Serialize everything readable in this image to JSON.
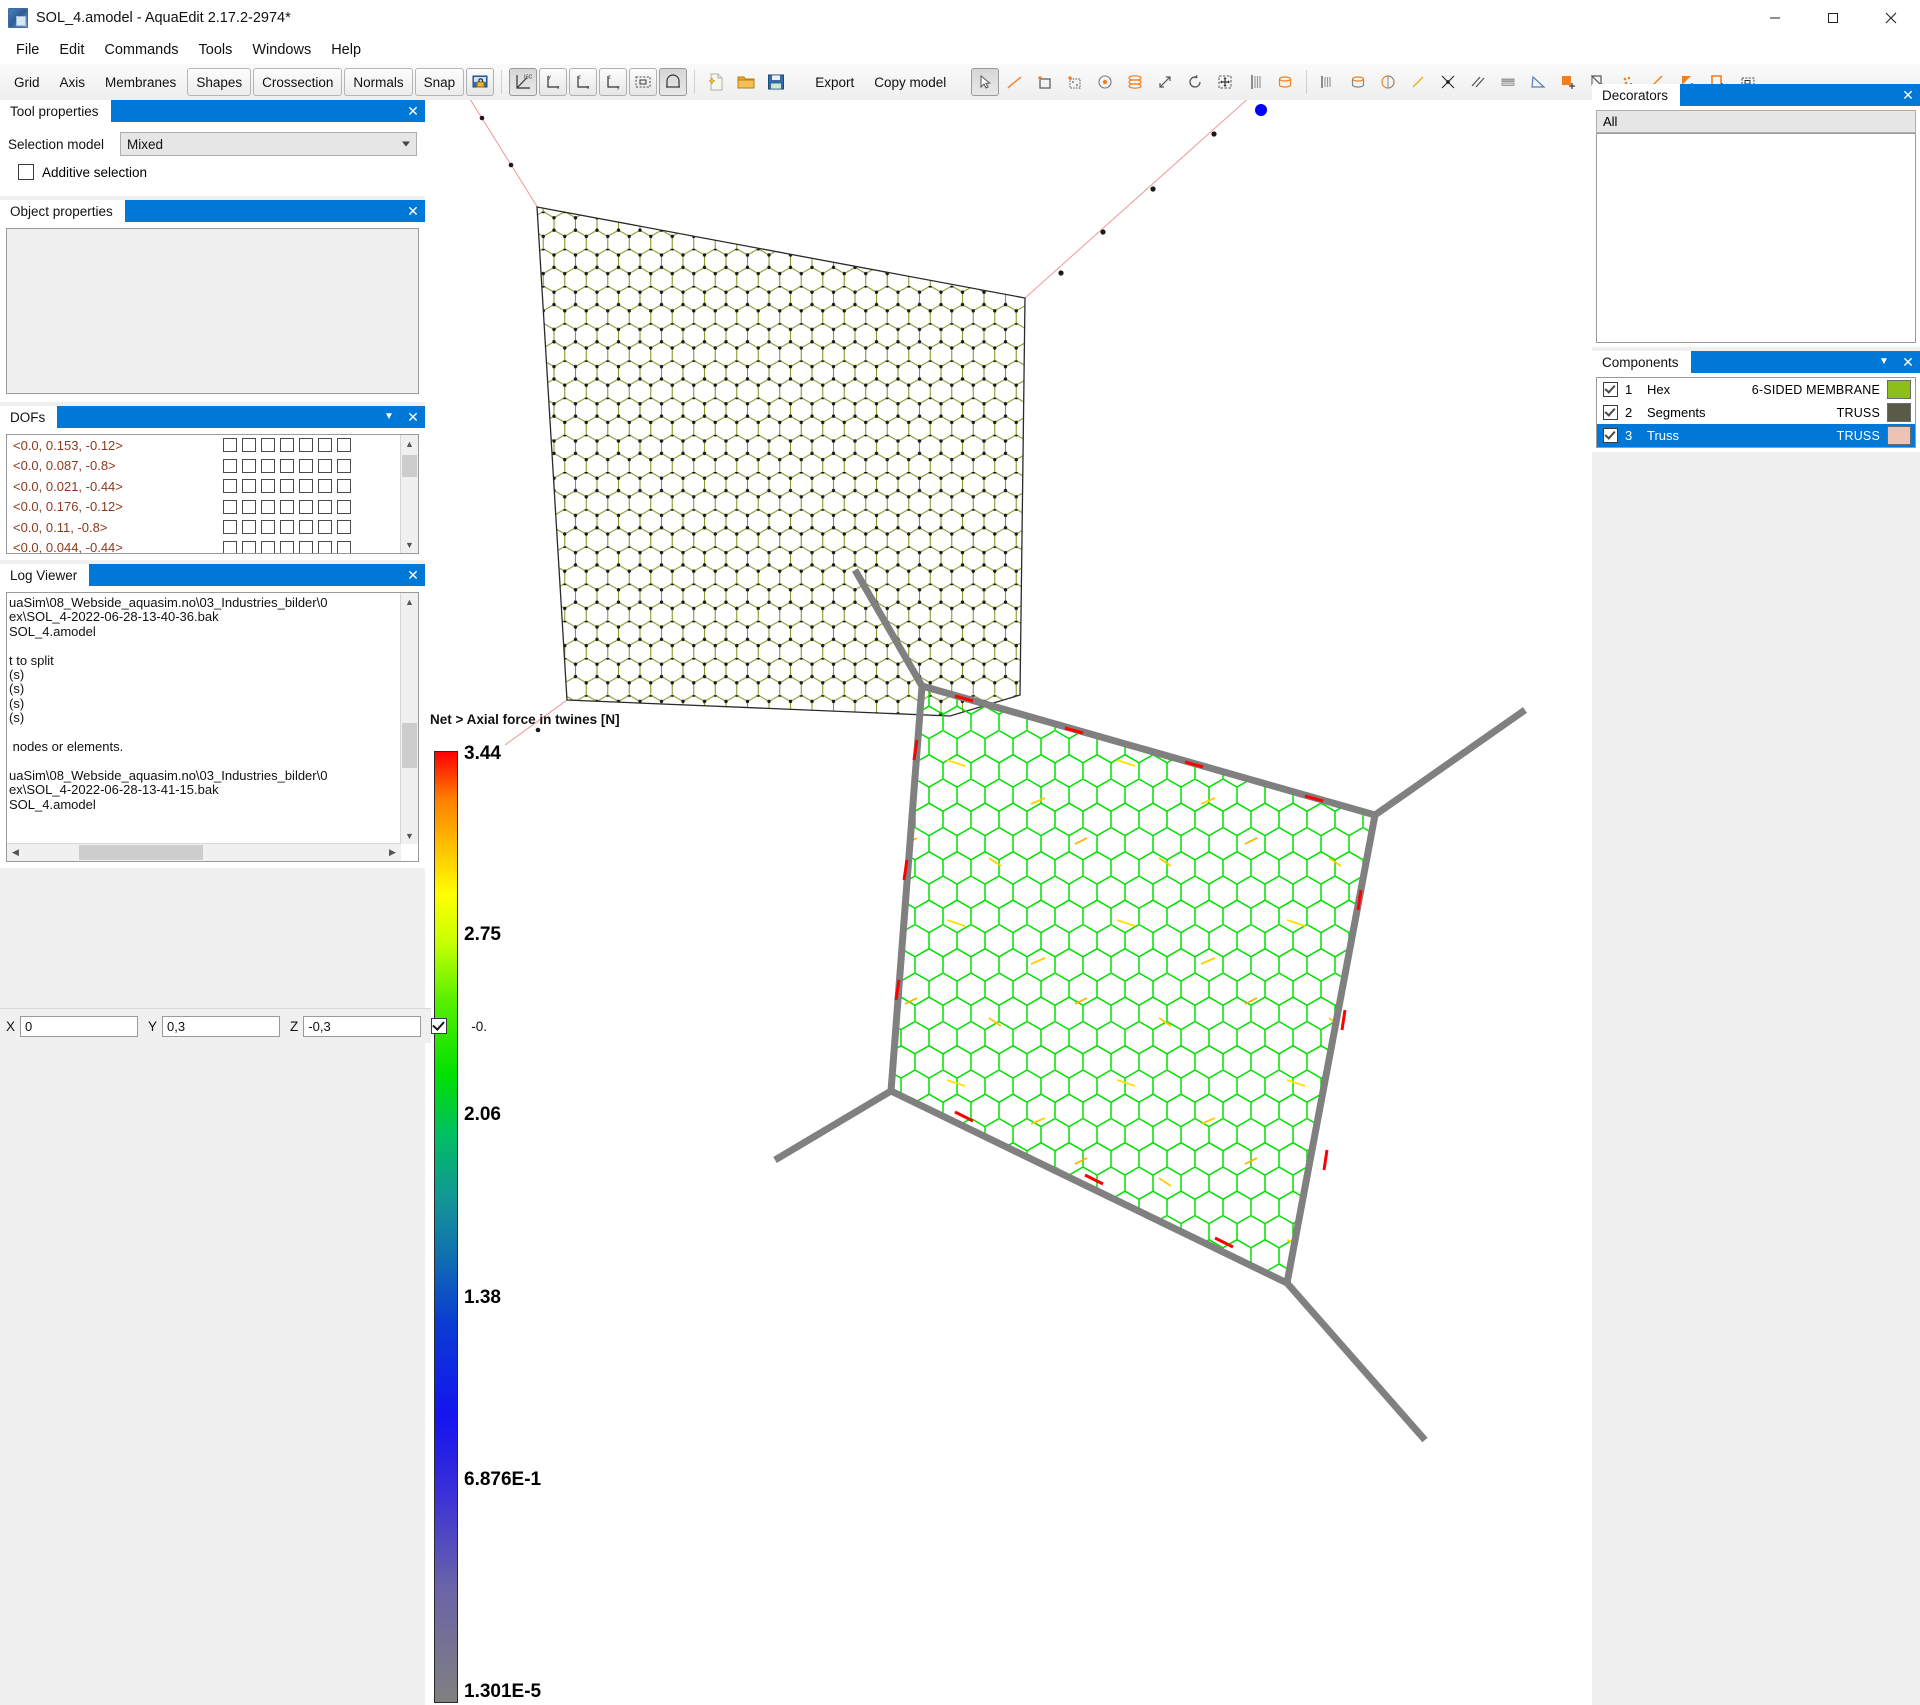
{
  "window": {
    "title": "SOL_4.amodel - AquaEdit 2.17.2-2974*",
    "minimize": "–",
    "maximize": "❐",
    "close": "✕"
  },
  "menu": {
    "items": [
      "File",
      "Edit",
      "Commands",
      "Tools",
      "Windows",
      "Help"
    ]
  },
  "toolbar": {
    "mode_buttons": [
      "Grid",
      "Axis",
      "Membranes",
      "Shapes",
      "Crossection",
      "Normals",
      "Snap"
    ],
    "active_mode": "Shapes",
    "lock_icon": "lock-view-icon",
    "view_icons": [
      "iso-view-icon",
      "yx-view-icon",
      "zx-view-icon",
      "zy-view-icon",
      "zoom-fit-icon",
      "membrane-view-icon"
    ],
    "file_icons": [
      "new-file-icon",
      "open-folder-icon",
      "save-disk-icon"
    ],
    "export_label": "Export",
    "copy_model_label": "Copy model",
    "edit_icons": [
      "select-arrow-icon",
      "draw-line-icon",
      "add-rect-icon",
      "add-mesh-icon",
      "add-point-icon",
      "add-volume-icon",
      "scale-icon",
      "rotate-icon",
      "move-icon",
      "mirror-icon",
      "extrude-icon",
      "split-cylinder-icon",
      "half-circle-icon",
      "line-segment-icon",
      "intersect-icon",
      "parallel-icon",
      "offset-icon",
      "angle-icon",
      "fill-square-icon",
      "copy-shape-icon",
      "points-add-icon",
      "line-add-icon",
      "triangle-add-icon",
      "square-add-icon",
      "bounding-box-icon"
    ]
  },
  "tool_properties": {
    "tab": "Tool properties",
    "close": "✕",
    "selection_model_label": "Selection model",
    "selection_model_value": "Mixed",
    "additive_selection_label": "Additive selection",
    "additive_selection_checked": false
  },
  "object_properties": {
    "tab": "Object properties",
    "close": "✕",
    "content": ""
  },
  "dofs": {
    "tab": "DOFs",
    "menu": "▼",
    "close": "✕",
    "checkbox_count": 7,
    "rows": [
      "<0.0, 0.153, -0.12>",
      "<0.0, 0.087, -0.8>",
      "<0.0, 0.021, -0.44>",
      "<0.0, 0.176, -0.12>",
      "<0.0, 0.11, -0.8>",
      "<0.0, 0.044, -0.44>"
    ]
  },
  "log_viewer": {
    "tab": "Log Viewer",
    "close": "✕",
    "lines": [
      "uaSim\\08_Webside_aquasim.no\\03_Industries_bilder\\0",
      "ex\\SOL_4-2022-06-28-13-40-36.bak",
      "SOL_4.amodel",
      "",
      "t to split",
      "(s)",
      "(s)",
      "(s)",
      "(s)",
      "",
      " nodes or elements.",
      "",
      "uaSim\\08_Webside_aquasim.no\\03_Industries_bilder\\0",
      "ex\\SOL_4-2022-06-28-13-41-15.bak",
      "SOL_4.amodel"
    ]
  },
  "coordbar": {
    "x_label": "X",
    "x_value": "0",
    "y_label": "Y",
    "y_value": "0,3",
    "z_label": "Z",
    "z_value": "-0,3",
    "lock_checked": true,
    "extra_value": "-0."
  },
  "decorators": {
    "tab": "Decorators",
    "close": "✕",
    "filter_value": "All",
    "items": []
  },
  "components": {
    "tab": "Components",
    "menu": "▼",
    "close": "✕",
    "rows": [
      {
        "index": "1",
        "name": "Hex",
        "type": "6-SIDED MEMBRANE",
        "color": "#8CC019",
        "checked": true,
        "selected": false
      },
      {
        "index": "2",
        "name": "Segments",
        "type": "TRUSS",
        "color": "#5A5A48",
        "checked": true,
        "selected": false
      },
      {
        "index": "3",
        "name": "Truss",
        "type": "TRUSS",
        "color": "#EFC3B4",
        "checked": true,
        "selected": true
      }
    ]
  },
  "legend": {
    "title": "Net > Axial force in twines [N]",
    "ticks": [
      "3.44",
      "2.75",
      "2.06",
      "1.38",
      "6.876E-1",
      "1.301E-5"
    ]
  },
  "chart_data": {
    "type": "heatmap",
    "title": "Net > Axial force in twines [N]",
    "colorbar_ticks": [
      3.44,
      2.75,
      2.06,
      1.38,
      0.6876,
      1.301e-05
    ],
    "colorbar_tick_labels": [
      "3.44",
      "2.75",
      "2.06",
      "1.38",
      "6.876E-1",
      "1.301E-5"
    ],
    "vmin": 1.301e-05,
    "vmax": 3.44,
    "unit": "N",
    "colormap_stops": [
      {
        "pos": 0.0,
        "color": "#808080"
      },
      {
        "pos": 0.12,
        "color": "#6A64A8"
      },
      {
        "pos": 0.27,
        "color": "#1414F0"
      },
      {
        "pos": 0.4,
        "color": "#0A3CD2"
      },
      {
        "pos": 0.52,
        "color": "#129696"
      },
      {
        "pos": 0.63,
        "color": "#00E000"
      },
      {
        "pos": 0.74,
        "color": "#5AF000"
      },
      {
        "pos": 0.82,
        "color": "#FFFF00"
      },
      {
        "pos": 0.9,
        "color": "#FFA000"
      },
      {
        "pos": 1.0,
        "color": "#FF0000"
      }
    ],
    "legend_position": "left",
    "series": [
      {
        "name": "upper net (unshaded hex mesh)",
        "dominant_color": "#8A9A2B"
      },
      {
        "name": "lower net (axial force colored)",
        "dominant_color": "#00E000"
      }
    ],
    "xlabel": "",
    "ylabel": ""
  },
  "viewport": {
    "upper_net": {
      "name": "hex-membrane-net",
      "mesh_color": "#8a9a2b",
      "node_color": "#1a1a1a",
      "rope_color": "#f0a0a0",
      "anchor_node_color": "#0000ff"
    },
    "lower_net": {
      "name": "axial-force-net",
      "frame_color": "#808080",
      "mesh_color": "#00e000"
    }
  }
}
